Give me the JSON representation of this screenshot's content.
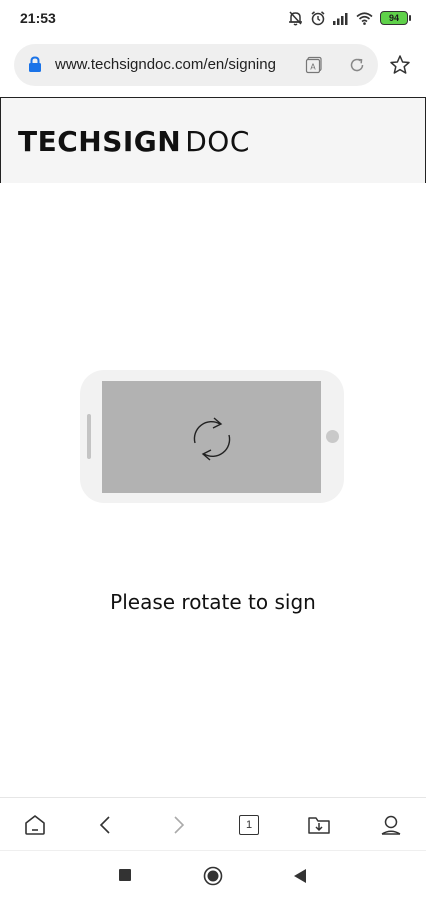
{
  "status_bar": {
    "time": "21:53",
    "battery": "94",
    "icons": [
      "notifications-off-icon",
      "alarm-icon",
      "signal-icon",
      "wifi-icon",
      "battery-icon"
    ]
  },
  "browser": {
    "url": "www.techsigndoc.com/en/signing",
    "icons": [
      "lock-icon",
      "translate-icon",
      "reload-icon",
      "star-icon"
    ]
  },
  "page": {
    "logo_bold": "TECHSIGN",
    "logo_light": "DOC",
    "message": "Please rotate to sign"
  },
  "toolbar": {
    "tab_count": "1",
    "icons": [
      "home-icon",
      "back-icon",
      "forward-icon",
      "tabs-icon",
      "downloads-icon",
      "profile-icon"
    ]
  },
  "nav_bar": {
    "icons": [
      "recents-icon",
      "home-circle-icon",
      "back-triangle-icon"
    ]
  },
  "colors": {
    "lock": "#1a73e8",
    "battery": "#5fd14a",
    "header_bg": "#f5f5f5",
    "phone_screen": "#b2b2b2"
  }
}
